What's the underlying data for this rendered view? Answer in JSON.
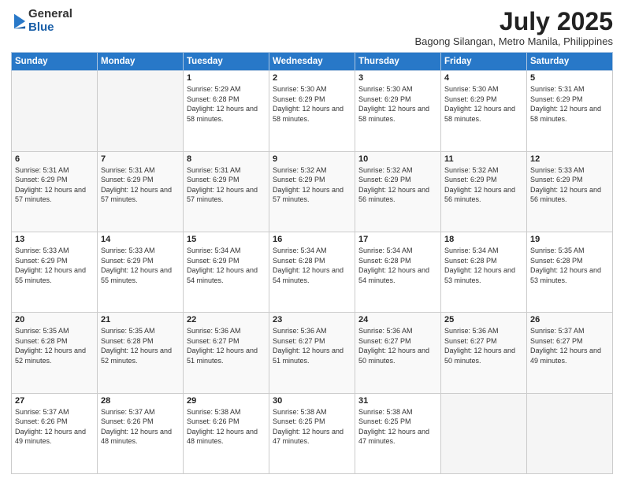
{
  "logo": {
    "general": "General",
    "blue": "Blue"
  },
  "title": "July 2025",
  "subtitle": "Bagong Silangan, Metro Manila, Philippines",
  "weekdays": [
    "Sunday",
    "Monday",
    "Tuesday",
    "Wednesday",
    "Thursday",
    "Friday",
    "Saturday"
  ],
  "weeks": [
    [
      {
        "day": "",
        "info": ""
      },
      {
        "day": "",
        "info": ""
      },
      {
        "day": "1",
        "info": "Sunrise: 5:29 AM\nSunset: 6:28 PM\nDaylight: 12 hours and 58 minutes."
      },
      {
        "day": "2",
        "info": "Sunrise: 5:30 AM\nSunset: 6:29 PM\nDaylight: 12 hours and 58 minutes."
      },
      {
        "day": "3",
        "info": "Sunrise: 5:30 AM\nSunset: 6:29 PM\nDaylight: 12 hours and 58 minutes."
      },
      {
        "day": "4",
        "info": "Sunrise: 5:30 AM\nSunset: 6:29 PM\nDaylight: 12 hours and 58 minutes."
      },
      {
        "day": "5",
        "info": "Sunrise: 5:31 AM\nSunset: 6:29 PM\nDaylight: 12 hours and 58 minutes."
      }
    ],
    [
      {
        "day": "6",
        "info": "Sunrise: 5:31 AM\nSunset: 6:29 PM\nDaylight: 12 hours and 57 minutes."
      },
      {
        "day": "7",
        "info": "Sunrise: 5:31 AM\nSunset: 6:29 PM\nDaylight: 12 hours and 57 minutes."
      },
      {
        "day": "8",
        "info": "Sunrise: 5:31 AM\nSunset: 6:29 PM\nDaylight: 12 hours and 57 minutes."
      },
      {
        "day": "9",
        "info": "Sunrise: 5:32 AM\nSunset: 6:29 PM\nDaylight: 12 hours and 57 minutes."
      },
      {
        "day": "10",
        "info": "Sunrise: 5:32 AM\nSunset: 6:29 PM\nDaylight: 12 hours and 56 minutes."
      },
      {
        "day": "11",
        "info": "Sunrise: 5:32 AM\nSunset: 6:29 PM\nDaylight: 12 hours and 56 minutes."
      },
      {
        "day": "12",
        "info": "Sunrise: 5:33 AM\nSunset: 6:29 PM\nDaylight: 12 hours and 56 minutes."
      }
    ],
    [
      {
        "day": "13",
        "info": "Sunrise: 5:33 AM\nSunset: 6:29 PM\nDaylight: 12 hours and 55 minutes."
      },
      {
        "day": "14",
        "info": "Sunrise: 5:33 AM\nSunset: 6:29 PM\nDaylight: 12 hours and 55 minutes."
      },
      {
        "day": "15",
        "info": "Sunrise: 5:34 AM\nSunset: 6:29 PM\nDaylight: 12 hours and 54 minutes."
      },
      {
        "day": "16",
        "info": "Sunrise: 5:34 AM\nSunset: 6:28 PM\nDaylight: 12 hours and 54 minutes."
      },
      {
        "day": "17",
        "info": "Sunrise: 5:34 AM\nSunset: 6:28 PM\nDaylight: 12 hours and 54 minutes."
      },
      {
        "day": "18",
        "info": "Sunrise: 5:34 AM\nSunset: 6:28 PM\nDaylight: 12 hours and 53 minutes."
      },
      {
        "day": "19",
        "info": "Sunrise: 5:35 AM\nSunset: 6:28 PM\nDaylight: 12 hours and 53 minutes."
      }
    ],
    [
      {
        "day": "20",
        "info": "Sunrise: 5:35 AM\nSunset: 6:28 PM\nDaylight: 12 hours and 52 minutes."
      },
      {
        "day": "21",
        "info": "Sunrise: 5:35 AM\nSunset: 6:28 PM\nDaylight: 12 hours and 52 minutes."
      },
      {
        "day": "22",
        "info": "Sunrise: 5:36 AM\nSunset: 6:27 PM\nDaylight: 12 hours and 51 minutes."
      },
      {
        "day": "23",
        "info": "Sunrise: 5:36 AM\nSunset: 6:27 PM\nDaylight: 12 hours and 51 minutes."
      },
      {
        "day": "24",
        "info": "Sunrise: 5:36 AM\nSunset: 6:27 PM\nDaylight: 12 hours and 50 minutes."
      },
      {
        "day": "25",
        "info": "Sunrise: 5:36 AM\nSunset: 6:27 PM\nDaylight: 12 hours and 50 minutes."
      },
      {
        "day": "26",
        "info": "Sunrise: 5:37 AM\nSunset: 6:27 PM\nDaylight: 12 hours and 49 minutes."
      }
    ],
    [
      {
        "day": "27",
        "info": "Sunrise: 5:37 AM\nSunset: 6:26 PM\nDaylight: 12 hours and 49 minutes."
      },
      {
        "day": "28",
        "info": "Sunrise: 5:37 AM\nSunset: 6:26 PM\nDaylight: 12 hours and 48 minutes."
      },
      {
        "day": "29",
        "info": "Sunrise: 5:38 AM\nSunset: 6:26 PM\nDaylight: 12 hours and 48 minutes."
      },
      {
        "day": "30",
        "info": "Sunrise: 5:38 AM\nSunset: 6:25 PM\nDaylight: 12 hours and 47 minutes."
      },
      {
        "day": "31",
        "info": "Sunrise: 5:38 AM\nSunset: 6:25 PM\nDaylight: 12 hours and 47 minutes."
      },
      {
        "day": "",
        "info": ""
      },
      {
        "day": "",
        "info": ""
      }
    ]
  ]
}
